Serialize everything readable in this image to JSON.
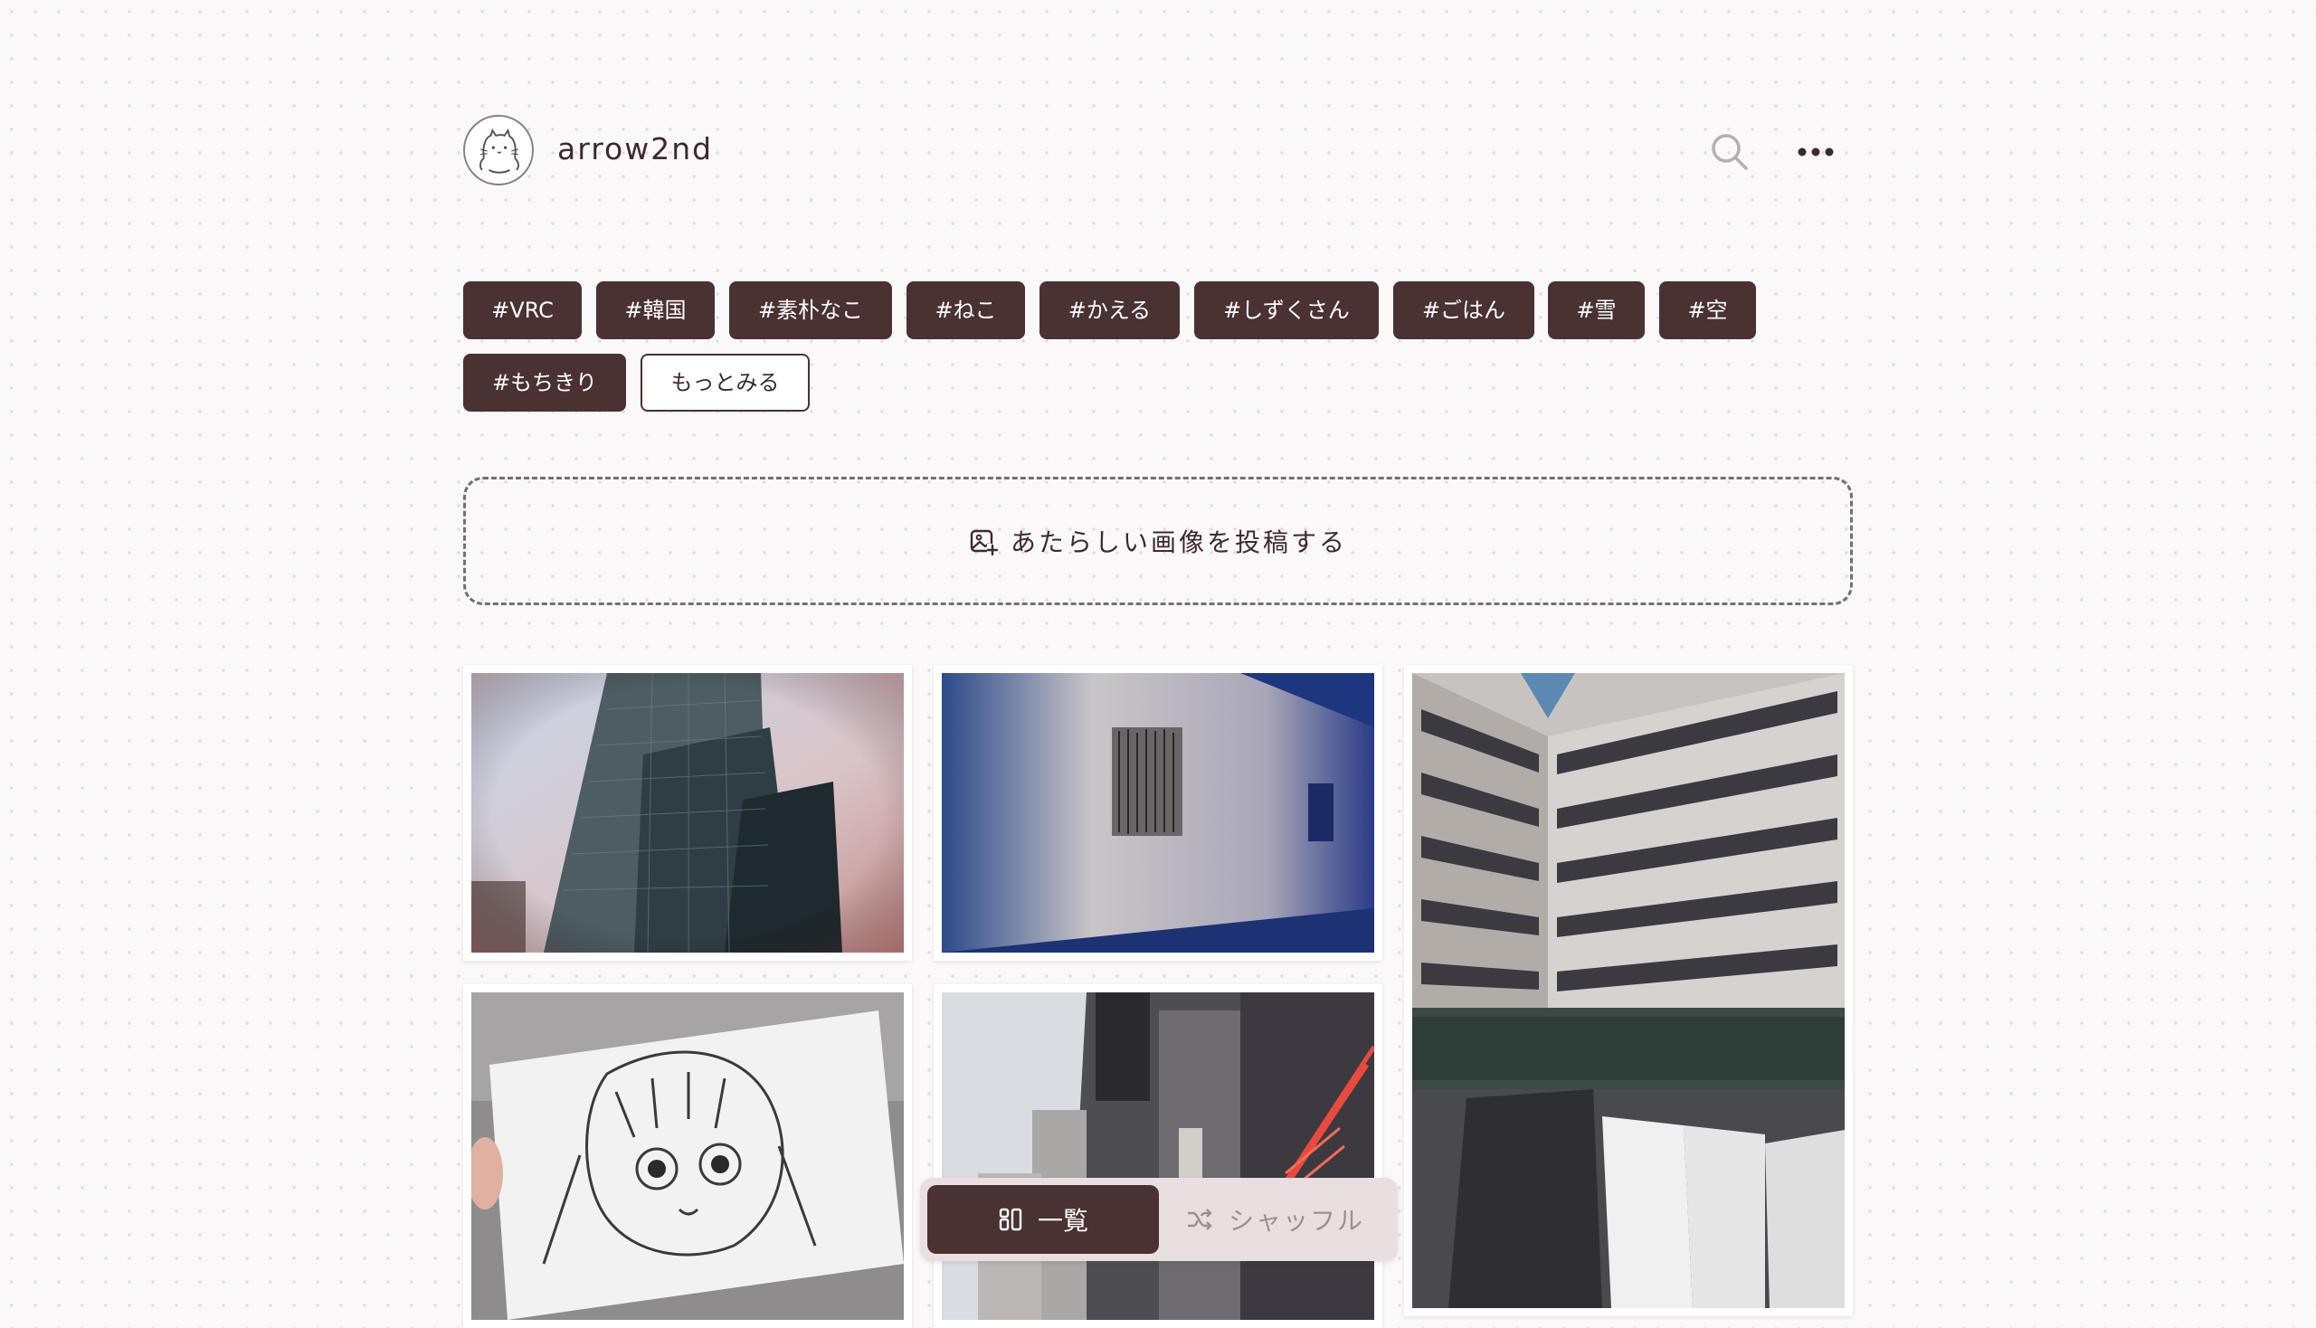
{
  "header": {
    "username": "arrow2nd"
  },
  "icons": {
    "avatar": "cat-doodle-icon",
    "search": "search-icon",
    "more": "more-dots-icon",
    "upload": "image-plus-icon",
    "list_view": "grid-view-icon",
    "shuffle": "shuffle-icon"
  },
  "tags": {
    "items": [
      "#VRC",
      "#韓国",
      "#素朴なこ",
      "#ねこ",
      "#かえる",
      "#しずくさん",
      "#ごはん",
      "#雪",
      "#空",
      "#もちきり"
    ],
    "more_label": "もっとみる"
  },
  "upload": {
    "label": "あたらしい画像を投稿する"
  },
  "view_toggle": {
    "list_label": "一覧",
    "shuffle_label": "シャッフル",
    "selected": "一覧"
  },
  "colors": {
    "accent": "#4a3132",
    "background": "#fbf8f9"
  }
}
